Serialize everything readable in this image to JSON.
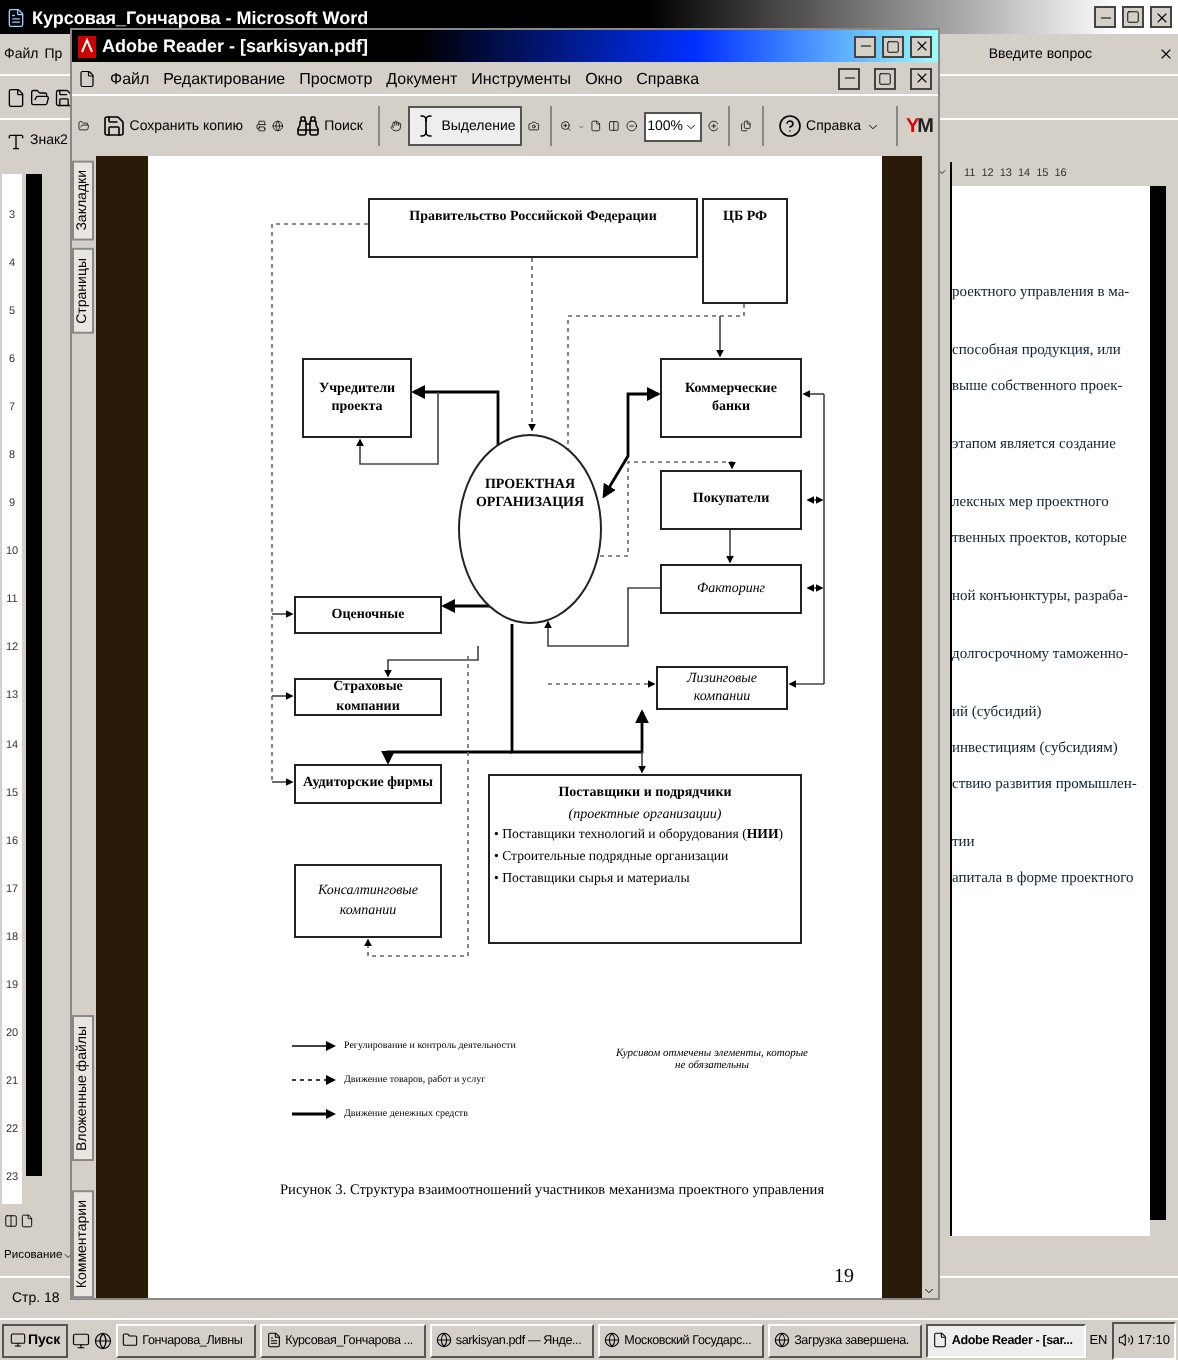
{
  "word": {
    "title": "Курсовая_Гончарова - Microsoft Word",
    "menu": [
      "Файл",
      "Пр"
    ],
    "question_placeholder": "Введите вопрос",
    "style": "Знак2",
    "vertical_ruler": [
      "3",
      "4",
      "5",
      "6",
      "7",
      "8",
      "9",
      "10",
      "11",
      "12",
      "13",
      "14",
      "15",
      "16",
      "17",
      "18",
      "19",
      "20",
      "21",
      "22",
      "23"
    ],
    "horizontal_ruler": [
      "11",
      "12",
      "13",
      "14",
      "15",
      "16"
    ],
    "paragraphs": [
      [
        "роектного управления в ма-"
      ],
      [
        "способная продукция, или",
        "выше собственного проек-"
      ],
      [
        "этапом является создание"
      ],
      [
        "лексных мер проектного",
        "твенных проектов, которые"
      ],
      [
        "ной конъюнктуры, разраба-"
      ],
      [
        "долгосрочному таможенно-"
      ],
      [
        "ий (субсидий)",
        "инвестициям (субсидиям)",
        "ствию развития промышлен-"
      ],
      [
        "тии",
        "апитала в форме проектного"
      ]
    ],
    "drawing_menu": "Рисование",
    "status": "Стр. 18"
  },
  "reader": {
    "title": "Adobe Reader - [sarkisyan.pdf]",
    "menu": [
      "Файл",
      "Редактирование",
      "Просмотр",
      "Документ",
      "Инструменты",
      "Окно",
      "Справка"
    ],
    "toolbar": {
      "save_copy": "Сохранить копию",
      "search": "Поиск",
      "select": {
        "label": "Выделение",
        "selected": true
      },
      "zoom": "100%",
      "help": "Справка",
      "logo": "YM"
    },
    "nav_tabs": [
      {
        "label": "Закладки",
        "selected": false
      },
      {
        "label": "Страницы",
        "selected": false
      },
      {
        "label": "Вложенные файлы",
        "selected": false
      },
      {
        "label": "Комментарии",
        "selected": false
      }
    ]
  },
  "figure": {
    "nodes": [
      {
        "kind": "box",
        "lines": [
          "Правительство Российской Федерации"
        ],
        "optional": false
      },
      {
        "kind": "box",
        "lines": [
          "ЦБ РФ"
        ],
        "optional": false
      },
      {
        "kind": "box",
        "lines": [
          "Учредители",
          "проекта"
        ],
        "optional": false
      },
      {
        "kind": "ellipse",
        "lines": [
          "ПРОЕКТНАЯ",
          "ОРГАНИЗАЦИЯ"
        ],
        "optional": false
      },
      {
        "kind": "box",
        "lines": [
          "Коммерческие",
          "банки"
        ],
        "optional": false
      },
      {
        "kind": "box",
        "lines": [
          "Покупатели"
        ],
        "optional": false
      },
      {
        "kind": "box",
        "lines": [
          "Факторинг"
        ],
        "optional": true
      },
      {
        "kind": "box",
        "lines": [
          "Оценочные"
        ],
        "optional": false
      },
      {
        "kind": "box",
        "lines": [
          "Страховые компании"
        ],
        "optional": false
      },
      {
        "kind": "box",
        "lines": [
          "Лизинговые компании"
        ],
        "optional": true
      },
      {
        "kind": "box",
        "lines": [
          "Аудиторские фирмы"
        ],
        "optional": false
      },
      {
        "kind": "list",
        "title": "Поставщики и подрядчики",
        "subtitle": "(проектные организации)",
        "items": [
          "• Поставщики технологий и оборудования (**НИИ**)",
          "• Строительные подрядные организации",
          "• Поставщики сырья и материалы"
        ]
      },
      {
        "kind": "box",
        "lines": [
          "Консалтинговые",
          "компании"
        ],
        "optional": true
      }
    ],
    "legend": [
      {
        "kind": "thin",
        "label": "Регулирование и контроль деятельности"
      },
      {
        "kind": "dotted",
        "label": "Движение товаров, работ и услуг"
      },
      {
        "kind": "bold",
        "label": "Движение денежных средств"
      }
    ],
    "note": "Курсивом отмечены элементы, которые не обязательны",
    "caption": "Рисунок 3. Структура взаимоотношений участников механизма проектного управления",
    "page_number": "19"
  },
  "taskbar": {
    "start": "Пуск",
    "tasks": [
      {
        "label": "Гончарова_Ливны",
        "kind": "folder",
        "selected": false
      },
      {
        "label": "Курсовая_Гончарова ...",
        "kind": "word",
        "selected": false
      },
      {
        "label": "sarkisyan.pdf — Янде...",
        "kind": "browser",
        "selected": false
      },
      {
        "label": "Московский Государс...",
        "kind": "browser",
        "selected": false
      },
      {
        "label": "Загрузка завершена.",
        "kind": "browser",
        "selected": false
      },
      {
        "label": "Adobe Reader - [sar...",
        "kind": "pdf",
        "selected": true
      }
    ],
    "lang": "EN",
    "clock": "17:10"
  }
}
